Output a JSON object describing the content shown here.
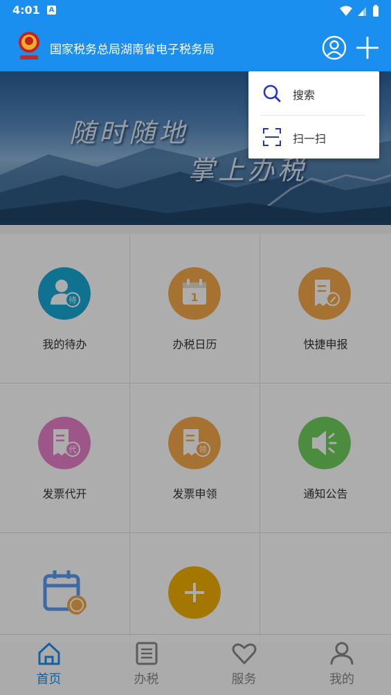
{
  "status_bar": {
    "time": "4:01",
    "notification_letter": "A"
  },
  "app_bar": {
    "title": "国家税务总局湖南省电子税务局"
  },
  "banner": {
    "line1": "随时随地",
    "line2": "掌上办税"
  },
  "grid": {
    "items": [
      {
        "label": "我的待办",
        "icon": "todo-user-icon",
        "color": "#17a8d4",
        "badge": "待"
      },
      {
        "label": "办税日历",
        "icon": "calendar-icon",
        "color": "#f5a94a",
        "badge": "1"
      },
      {
        "label": "快捷申报",
        "icon": "quick-declare-icon",
        "color": "#f5a94a",
        "badge": ""
      },
      {
        "label": "发票代开",
        "icon": "invoice-issue-icon",
        "color": "#e77fc9",
        "badge": "代"
      },
      {
        "label": "发票申领",
        "icon": "invoice-apply-icon",
        "color": "#f5a94a",
        "badge": "领"
      },
      {
        "label": "通知公告",
        "icon": "announcement-icon",
        "color": "#6fcf5d",
        "badge": ""
      },
      {
        "label": "",
        "icon": "calendar-appointment-icon",
        "color": "#5b9cf2",
        "badge": ""
      },
      {
        "label": "",
        "icon": "add-icon",
        "color": "#f2b000",
        "badge": ""
      }
    ]
  },
  "bottom_nav": {
    "items": [
      {
        "label": "首页",
        "icon": "home-icon",
        "active": true
      },
      {
        "label": "办税",
        "icon": "list-icon",
        "active": false
      },
      {
        "label": "服务",
        "icon": "heart-icon",
        "active": false
      },
      {
        "label": "我的",
        "icon": "person-icon",
        "active": false
      }
    ]
  },
  "popup_menu": {
    "items": [
      {
        "label": "搜索",
        "icon": "search-icon"
      },
      {
        "label": "扫一扫",
        "icon": "scan-icon"
      }
    ]
  },
  "colors": {
    "primary": "#1a8ff0",
    "popup_icon": "#2233c8"
  }
}
